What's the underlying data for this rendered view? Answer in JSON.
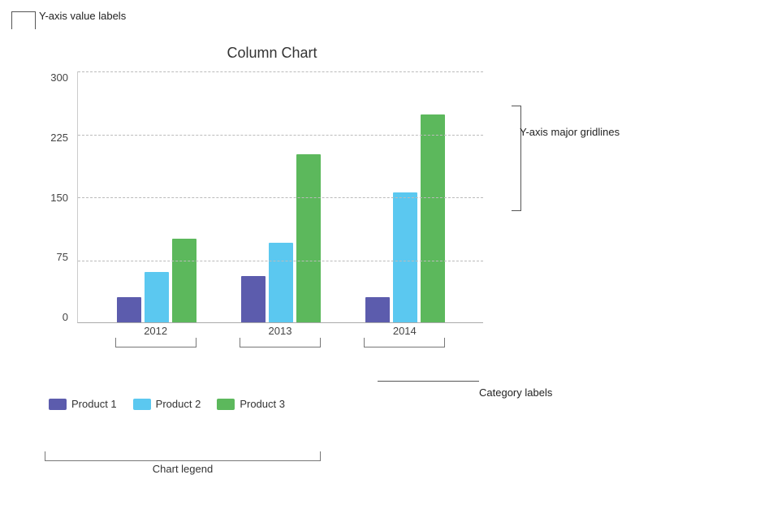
{
  "title": "Column Chart",
  "yAxis": {
    "labels": [
      "300",
      "225",
      "150",
      "75",
      "0"
    ]
  },
  "xAxis": {
    "labels": [
      "2012",
      "2013",
      "2014"
    ]
  },
  "series": [
    {
      "name": "Product 1",
      "color": "#5c5cad",
      "values": [
        30,
        55,
        30
      ]
    },
    {
      "name": "Product 2",
      "color": "#5bc8f0",
      "values": [
        60,
        95,
        155
      ]
    },
    {
      "name": "Product 3",
      "color": "#5cb85c",
      "values": [
        100,
        200,
        248
      ]
    }
  ],
  "maxValue": 300,
  "annotations": {
    "yAxisLabel": "Y-axis value labels",
    "yAxisGridlines": "Y-axis major gridlines",
    "categoryLabels": "Category labels",
    "chartLegend": "Chart legend"
  }
}
